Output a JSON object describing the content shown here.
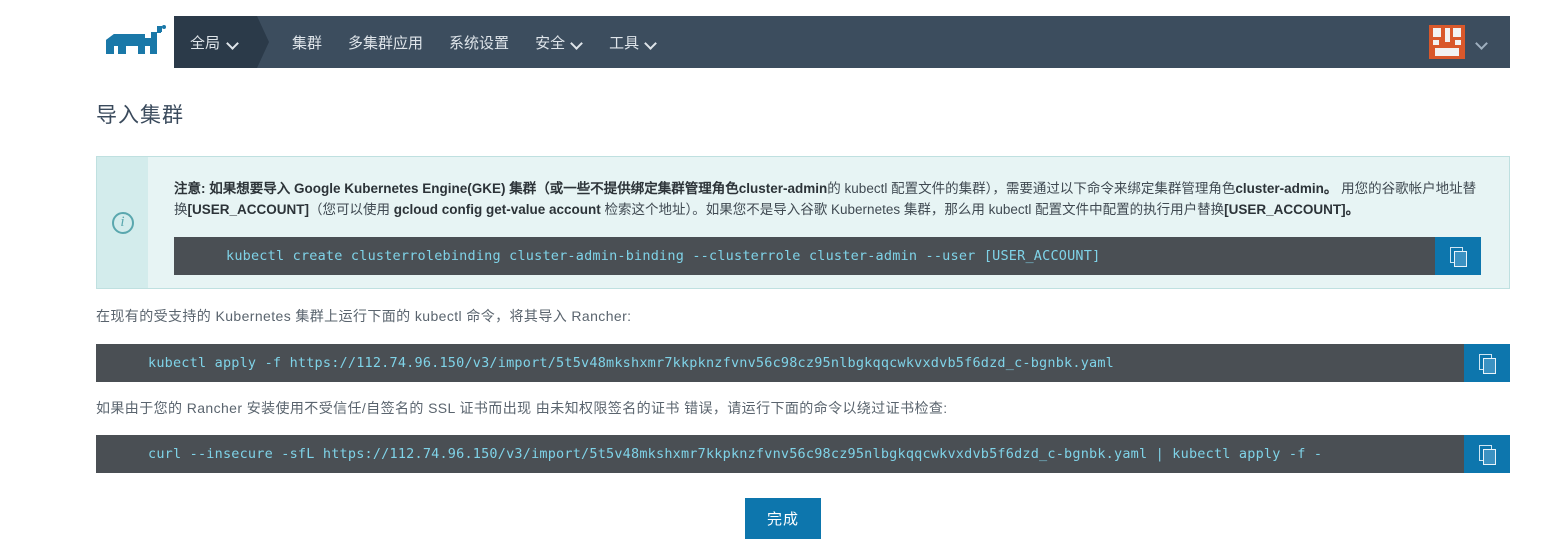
{
  "navbar": {
    "logo_name": "rancher-cow-logo",
    "active_item": {
      "label": "全局",
      "icon": "chevron-down-icon"
    },
    "items": [
      {
        "label": "集群",
        "has_caret": false
      },
      {
        "label": "多集群应用",
        "has_caret": false
      },
      {
        "label": "系统设置",
        "has_caret": false
      },
      {
        "label": "安全",
        "has_caret": true
      },
      {
        "label": "工具",
        "has_caret": true
      }
    ],
    "avatar_alt": "user-avatar",
    "avatar_color": "#d9582b",
    "background_color": "#3c4d5e",
    "active_background_color": "#2b3a49"
  },
  "page": {
    "title": "导入集群"
  },
  "notice": {
    "icon": "info-circle-icon",
    "background_color": "#e7f4f4",
    "border_color": "#bfe0e0",
    "line1_pre": "注意: 如果想要导入 Google Kubernetes Engine(GKE) 集群（或一些不提供绑定集群管理角色",
    "line1_b1": "cluster-admin",
    "line1_mid": "的 kubectl 配置文件的集群），需要通过以下命令来绑定集群管理角色",
    "line1_b2": "cluster-admin。",
    "line1_post": " 用您的谷歌帐户地址替换",
    "line1_b3": "[USER_ACCOUNT]",
    "line1_tail": "（您可以使用 ",
    "line2_b1": "gcloud config get-value account",
    "line2_mid": " 检索这个地址）。如果您不是导入谷歌 Kubernetes 集群，那么用 kubectl 配置文件中配置的执行用户替换",
    "line2_b2": "[USER_ACCOUNT]。",
    "command": "kubectl create clusterrolebinding cluster-admin-binding --clusterrole cluster-admin --user [USER_ACCOUNT]",
    "copy_label": "copy-icon"
  },
  "instructions": {
    "para1": "在现有的受支持的 Kubernetes 集群上运行下面的 kubectl 命令，将其导入 Rancher:",
    "command1": "kubectl apply -f https://112.74.96.150/v3/import/5t5v48mkshxmr7kkpknzfvnv56c98cz95nlbgkqqcwkvxdvb5f6dzd_c-bgnbk.yaml",
    "para2": "如果由于您的 Rancher 安装使用不受信任/自签名的 SSL 证书而出现 由未知权限签名的证书 错误，请运行下面的命令以绕过证书检查:",
    "command2": "curl --insecure -sfL https://112.74.96.150/v3/import/5t5v48mkshxmr7kkpknzfvnv56c98cz95nlbgkqqcwkvxdvb5f6dzd_c-bgnbk.yaml | kubectl apply -f -"
  },
  "footer": {
    "finish_label": "完成",
    "button_color": "#0d76ad"
  }
}
